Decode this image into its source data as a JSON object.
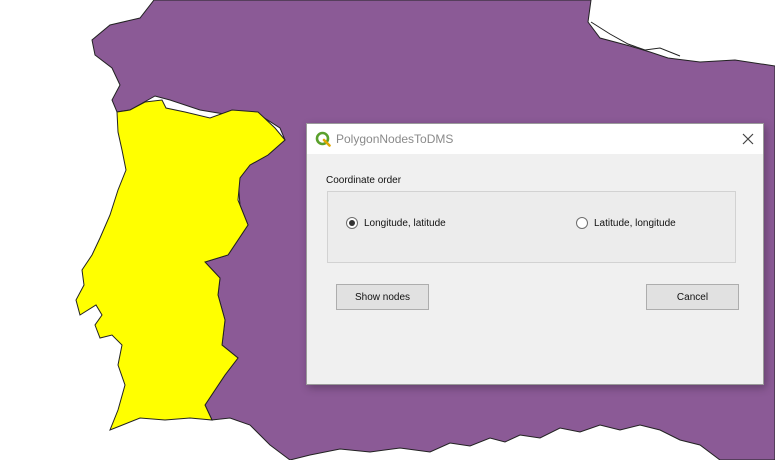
{
  "dialog": {
    "title": "PolygonNodesToDMS",
    "app_icon": "qgis-icon",
    "close_icon": "close-icon",
    "group_label": "Coordinate order",
    "options": [
      {
        "label": "Longitude, latitude",
        "selected": true
      },
      {
        "label": "Latitude, longitude",
        "selected": false
      }
    ],
    "show_nodes_label": "Show nodes",
    "cancel_label": "Cancel"
  },
  "map": {
    "portugal_fill": "#ffff00",
    "spain_fill": "#8b5a96",
    "background": "#ffffff"
  }
}
